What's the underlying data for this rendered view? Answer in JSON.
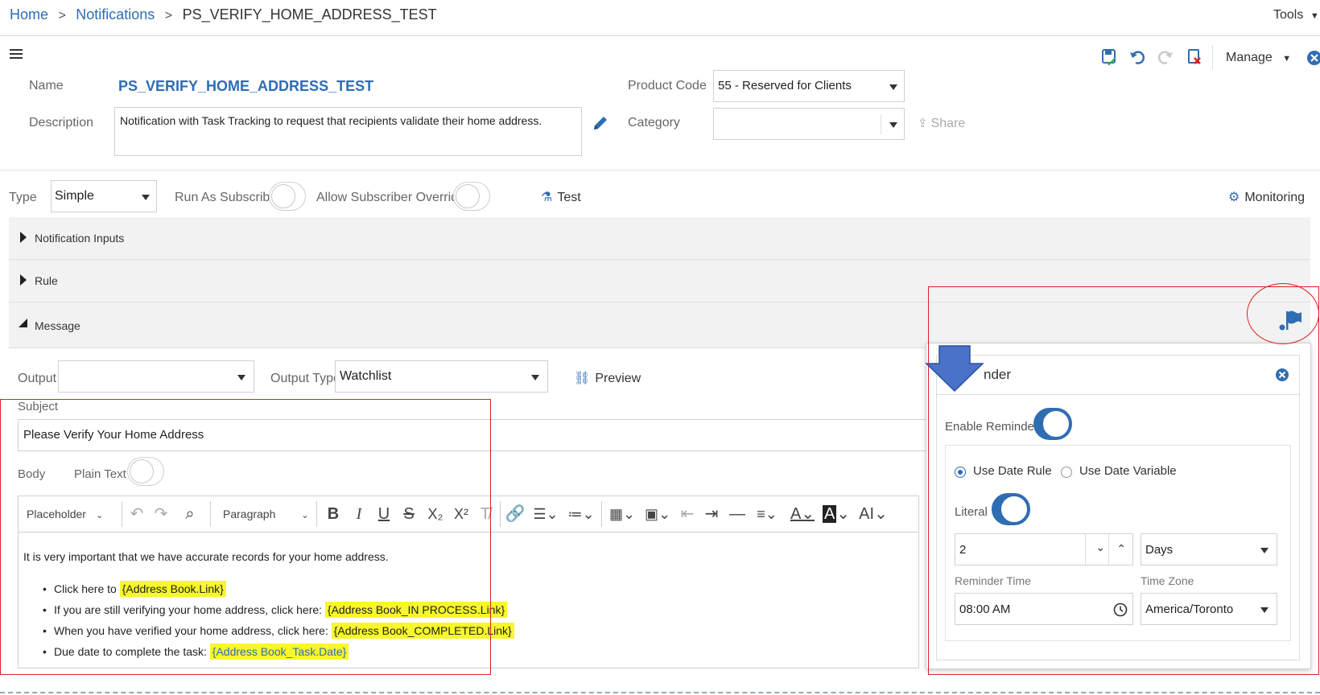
{
  "breadcrumb": {
    "home": "Home",
    "notifications": "Notifications",
    "current": "PS_VERIFY_HOME_ADDRESS_TEST",
    "sep": ">"
  },
  "topbar": {
    "tools": "Tools"
  },
  "header": {
    "manage": "Manage"
  },
  "form": {
    "name_label": "Name",
    "name_value": "PS_VERIFY_HOME_ADDRESS_TEST",
    "description_label": "Description",
    "description_value": "Notification with Task Tracking to request that recipients validate their home address.",
    "product_code_label": "Product Code",
    "product_code_value": "55 - Reserved for Clients",
    "category_label": "Category",
    "category_value": "",
    "share": "Share"
  },
  "settings": {
    "type_label": "Type",
    "type_value": "Simple",
    "run_as_subscriber": "Run As Subscriber",
    "allow_overrides": "Allow Subscriber Overrides",
    "test": "Test",
    "monitoring": "Monitoring"
  },
  "sections": {
    "inputs": "Notification Inputs",
    "rule": "Rule",
    "message": "Message"
  },
  "message": {
    "output_label": "Output",
    "output_value": "",
    "output_type_label": "Output Type",
    "output_type_value": "Watchlist",
    "preview": "Preview",
    "subject_label": "Subject",
    "subject_value": "Please Verify Your Home Address",
    "body_label": "Body",
    "plain_text": "Plain Text"
  },
  "editor_toolbar": {
    "placeholder": "Placeholder",
    "paragraph": "Paragraph",
    "bold": "B",
    "italic": "I",
    "underline": "U",
    "strike": "S",
    "subscript": "X₂",
    "superscript": "X²",
    "clear": "T̸",
    "font_size": "AI"
  },
  "body_content": {
    "intro": "It is very important that we have accurate records for your home address.",
    "items": [
      {
        "text": "Click here to ",
        "token": "{Address Book.Link}"
      },
      {
        "text": "If you are still verifying your home address, click here: ",
        "token": "{Address Book_IN PROCESS.Link}"
      },
      {
        "text": "When you have verified your home address, click here: ",
        "token": "{Address Book_COMPLETED.Link}"
      },
      {
        "text": "Due date to complete the task: ",
        "token": "{Address Book_Task.Date}"
      }
    ]
  },
  "reminder": {
    "title_partial": "nder",
    "enable_label": "Enable Reminder",
    "use_date_rule": "Use Date Rule",
    "use_date_variable": "Use Date Variable",
    "literal_label": "Literal",
    "literal_value": "2",
    "unit_value": "Days",
    "reminder_time_label": "Reminder Time",
    "reminder_time_value": "08:00 AM",
    "time_zone_label": "Time Zone",
    "time_zone_value": "America/Toronto"
  },
  "colors": {
    "accent": "#2f6db3",
    "highlight": "#f7f72a",
    "annotation": "#e02020",
    "arrow": "#4a72c8"
  }
}
